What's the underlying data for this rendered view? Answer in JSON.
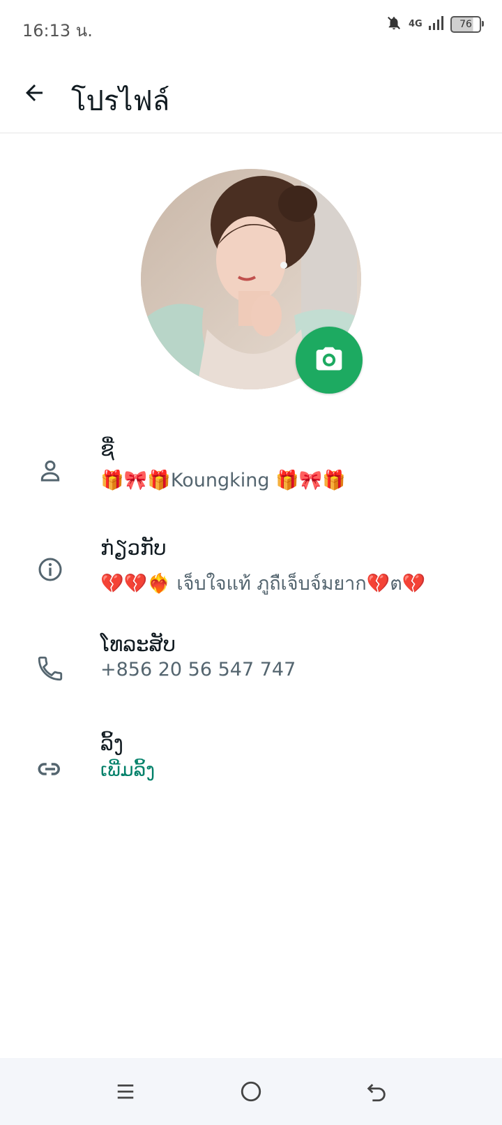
{
  "status_bar": {
    "time": "16:13 น.",
    "network": "4G",
    "battery": "76",
    "icons": [
      "bell-off-icon",
      "signal-icon",
      "battery-icon"
    ]
  },
  "header": {
    "title": "โปรไฟล์",
    "back_icon": "arrow-left-icon"
  },
  "profile": {
    "avatar_icon": "profile-photo",
    "camera_icon": "camera-icon"
  },
  "rows": [
    {
      "icon": "person-icon",
      "label": "ຊື່",
      "value": "🎁🎀🎁Koungking 🎁🎀🎁"
    },
    {
      "icon": "info-icon",
      "label": "ກ່ຽວກັບ",
      "value": "💔💔❤️‍🔥 เจ็บใจแท้ ภูถืเจ็บจ์มยาก💔ต💔"
    },
    {
      "icon": "phone-icon",
      "label": "ໂທລະສັບ",
      "value": "+856 20 56 547 747"
    },
    {
      "icon": "link-icon",
      "label": "ລິ້ງ",
      "value": "ເພີ່ມລິ້ງ"
    }
  ],
  "colors": {
    "accent": "#1daa61",
    "link": "#008069",
    "secondary_text": "#54656f",
    "icon_gray": "#54656f"
  },
  "nav_bar": {
    "icons": [
      "menu-icon",
      "home-icon",
      "back-icon"
    ]
  }
}
